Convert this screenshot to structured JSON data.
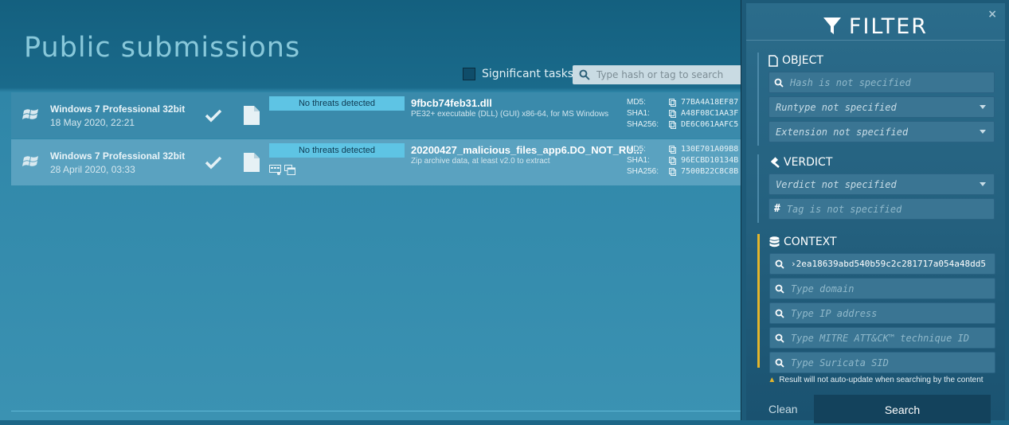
{
  "main": {
    "title": "Public submissions",
    "significant_label": "Significant tasks",
    "search_placeholder": "Type hash or tag to search"
  },
  "tasks": [
    {
      "os": "Windows 7 Professional 32bit",
      "date": "18 May 2020, 22:21",
      "verdict": "No threats detected",
      "filename": "9fbcb74feb31.dll",
      "description": "PE32+ executable (DLL) (GUI) x86-64, for MS Windows",
      "md5_label": "MD5:",
      "sha1_label": "SHA1:",
      "sha256_label": "SHA256:",
      "md5": "77BA4A18EF87",
      "sha1": "A48F08C1AA3F",
      "sha256": "DE6C061AAFC5"
    },
    {
      "os": "Windows 7 Professional 32bit",
      "date": "28 April 2020, 03:33",
      "verdict": "No threats detected",
      "filename": "20200427_malicious_files_app6.DO_NOT_RU...",
      "description": "Zip archive data, at least v2.0 to extract",
      "md5_label": "MD5:",
      "sha1_label": "SHA1:",
      "sha256_label": "SHA256:",
      "md5": "130E701A09B8",
      "sha1": "96ECBD10134B",
      "sha256": "7500B22C8C8B"
    }
  ],
  "filter": {
    "title": "FILTER",
    "close": "×",
    "object": {
      "title": "OBJECT",
      "hash_placeholder": "Hash is not specified",
      "runtype": "Runtype not specified",
      "extension": "Extension not specified"
    },
    "verdict": {
      "title": "VERDICT",
      "verdict": "Verdict not specified",
      "tag_placeholder": "Tag is not specified"
    },
    "context": {
      "title": "CONTEXT",
      "value": "›2ea18639abd540b59c2c281717a054a48dd5",
      "domain_placeholder": "Type domain",
      "ip_placeholder": "Type IP address",
      "mitre_placeholder": "Type MITRE ATT&CK™ technique ID",
      "suricata_placeholder": "Type Suricata SID"
    },
    "warning": "Result will not auto-update when searching by the content",
    "clean_label": "Clean",
    "search_label": "Search"
  },
  "colors": {
    "accent_yellow": "#e3b52c",
    "verdict_badge": "#5ec4e4",
    "panel": "#235f7d"
  },
  "icons": [
    "search-icon",
    "windows-logo-icon",
    "check-icon",
    "file-icon",
    "copy-icon",
    "filter-funnel-icon",
    "document-icon",
    "gavel-icon",
    "hash-icon",
    "database-icon",
    "warning-icon",
    "caret-down-icon"
  ]
}
